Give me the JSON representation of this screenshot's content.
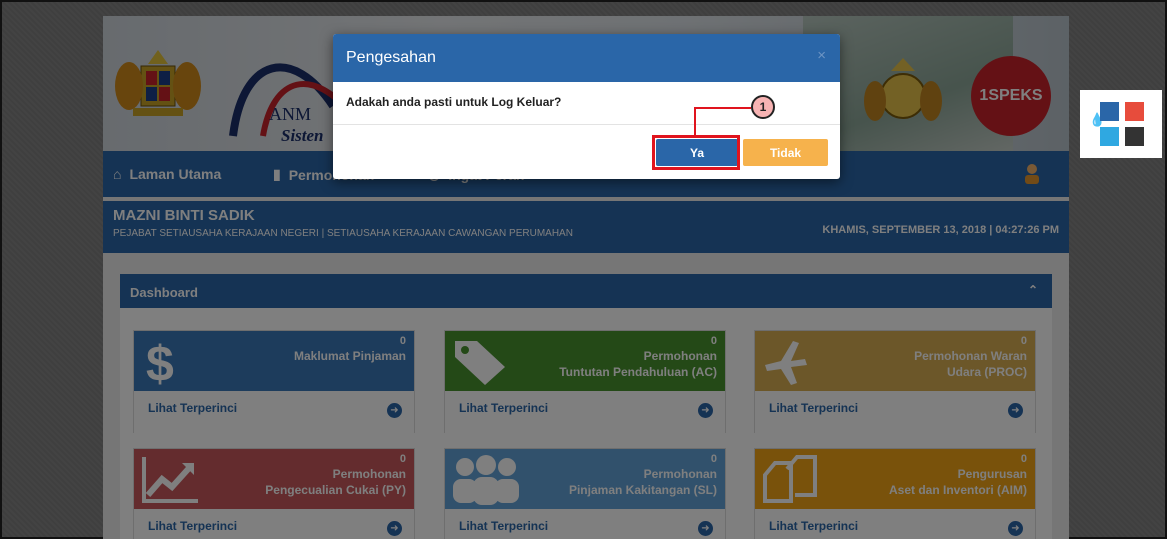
{
  "header": {
    "anm_text": "ANM",
    "anm_sub": "Sisten",
    "speks_logo": "1SPEKS"
  },
  "nav": {
    "items": [
      {
        "label": "Laman Utama",
        "icon": "home-icon"
      },
      {
        "label": "Permohonan",
        "icon": "document-icon"
      },
      {
        "label": "Ingat Perah",
        "icon": "clock-icon"
      }
    ]
  },
  "user": {
    "name": "MAZNI BINTI SADIK",
    "org": "PEJABAT SETIAUSAHA KERAJAAN NEGERI | SETIAUSAHA KERAJAAN CAWANGAN PERUMAHAN",
    "datetime": "KHAMIS, SEPTEMBER 13, 2018 | 04:27:26 PM"
  },
  "dashboard": {
    "title": "Dashboard",
    "more_label": "Lihat Terperinci",
    "cards": [
      {
        "count": "0",
        "title1": "Maklumat Pinjaman",
        "title2": "",
        "icon": "dollar-icon",
        "color": "#3a78b8"
      },
      {
        "count": "0",
        "title1": "Permohonan",
        "title2": "Tuntutan Pendahuluan (AC)",
        "icon": "tags-icon",
        "color": "#49922f"
      },
      {
        "count": "0",
        "title1": "Permohonan Waran",
        "title2": "Udara (PROC)",
        "icon": "plane-icon",
        "color": "#d8ae52"
      },
      {
        "count": "0",
        "title1": "Permohonan",
        "title2": "Pengecualian Cukai (PY)",
        "icon": "chart-up-icon",
        "color": "#c8595d"
      },
      {
        "count": "0",
        "title1": "Permohonan",
        "title2": "Pinjaman Kakitangan (SL)",
        "icon": "group-icon",
        "color": "#62a3d9"
      },
      {
        "count": "0",
        "title1": "Pengurusan",
        "title2": "Aset dan Inventori (AIM)",
        "icon": "copy-icon",
        "color": "#f2a516"
      }
    ]
  },
  "modal": {
    "title": "Pengesahan",
    "close": "×",
    "message": "Adakah anda pasti untuk Log Keluar?",
    "confirm_label": "Ya",
    "cancel_label": "Tidak"
  },
  "annotation": {
    "callout_number": "1"
  },
  "palette": {
    "colors": [
      "#2a66a8",
      "#e74c3c",
      "#2fa8e1",
      "#333333"
    ]
  }
}
